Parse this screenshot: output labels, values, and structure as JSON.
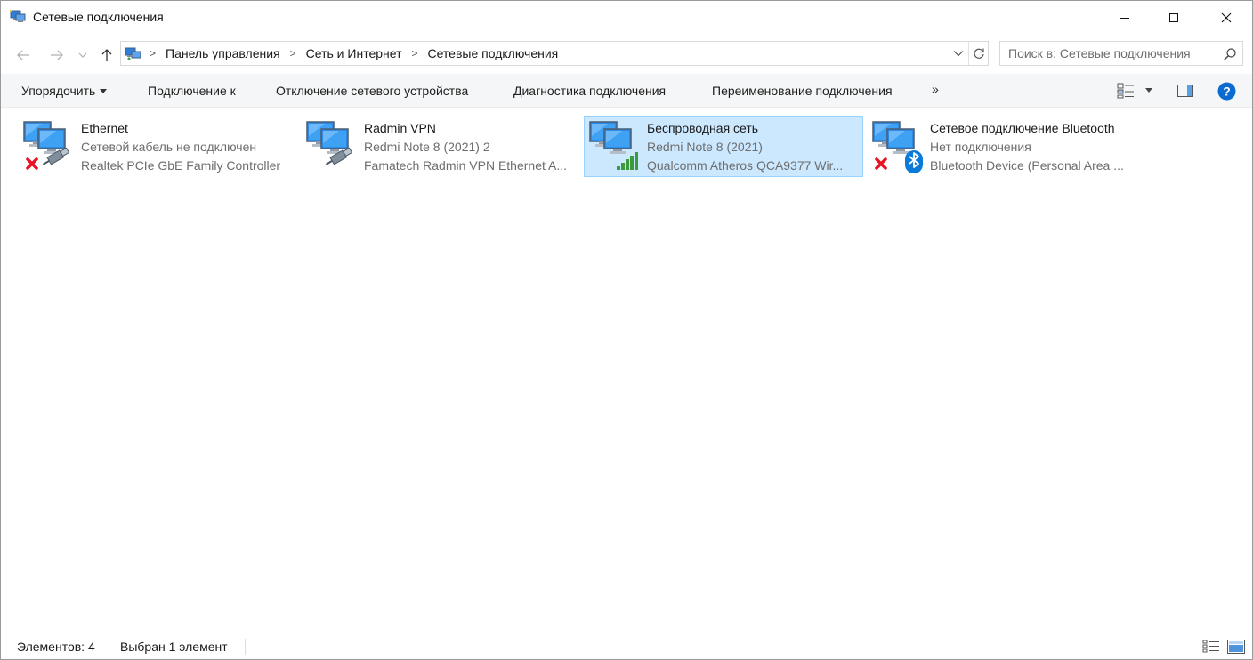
{
  "window": {
    "title": "Сетевые подключения",
    "title_icon": "network-connections-icon"
  },
  "navigation": {
    "back_icon": "arrow-left-icon",
    "forward_icon": "arrow-right-icon",
    "recent_icon": "chevron-down-icon",
    "up_icon": "arrow-up-icon",
    "breadcrumbs": [
      "Панель управления",
      "Сеть и Интернет",
      "Сетевые подключения"
    ],
    "search_placeholder": "Поиск в: Сетевые подключения"
  },
  "commandbar": {
    "organize": "Упорядочить",
    "connect_to": "Подключение к",
    "disable_device": "Отключение сетевого устройства",
    "diagnose": "Диагностика подключения",
    "rename": "Переименование подключения",
    "more": "»"
  },
  "connections": [
    {
      "name": "Ethernet",
      "status": "Сетевой кабель не подключен",
      "device": "Realtek PCIe GbE Family Controller",
      "icon": "ethernet-disconnected-icon",
      "selected": false
    },
    {
      "name": "Radmin VPN",
      "status": "Redmi Note 8 (2021) 2",
      "device": "Famatech Radmin VPN Ethernet A...",
      "icon": "ethernet-connected-icon",
      "selected": false
    },
    {
      "name": "Беспроводная сеть",
      "status": "Redmi Note 8 (2021)",
      "device": "Qualcomm Atheros QCA9377 Wir...",
      "icon": "wifi-signal-icon",
      "selected": true
    },
    {
      "name": "Сетевое подключение Bluetooth",
      "status": "Нет подключения",
      "device": "Bluetooth Device (Personal Area ...",
      "icon": "bluetooth-disconnected-icon",
      "selected": false
    }
  ],
  "statusbar": {
    "count": "Элементов: 4",
    "selected": "Выбран 1 элемент"
  },
  "colors": {
    "selection_bg": "#cce8ff",
    "selection_border": "#99d1ff",
    "commandbar_bg": "#f5f6f7",
    "help_blue": "#0b6bd1",
    "secondary_text": "#6d6d6d"
  }
}
